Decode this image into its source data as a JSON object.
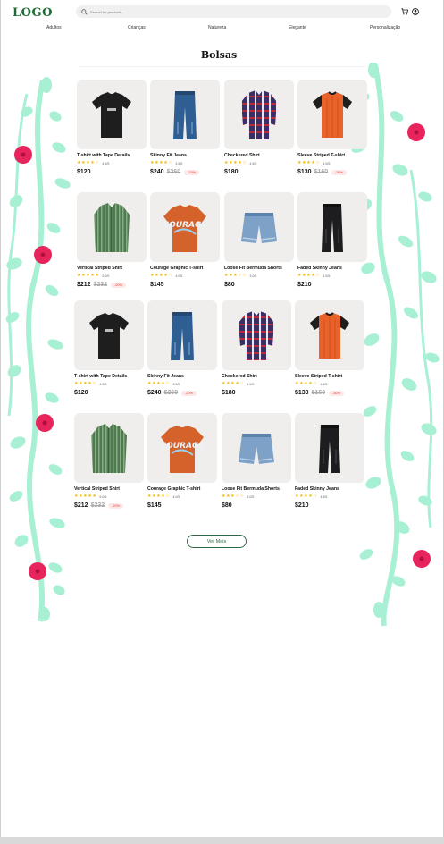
{
  "header": {
    "logo": "LOGO",
    "search_placeholder": "Search for products..."
  },
  "nav": [
    "Adultos",
    "Crianças",
    "Naturezа",
    "Elegante",
    "Personalização"
  ],
  "section": {
    "title": "Bolsas"
  },
  "products": [
    {
      "name": "T-shirt with Tape Details",
      "stars": "★★★★☆",
      "rating": "4.5/5",
      "price": "$120",
      "old_price": "",
      "discount": "",
      "image": "tshirt-black"
    },
    {
      "name": "Skinny Fit Jeans",
      "stars": "★★★★☆",
      "rating": "3.5/5",
      "price": "$240",
      "old_price": "$260",
      "discount": "-20%",
      "image": "jeans-blue"
    },
    {
      "name": "Checkered Shirt",
      "stars": "★★★★☆",
      "rating": "4.5/5",
      "price": "$180",
      "old_price": "",
      "discount": "",
      "image": "checkered-shirt"
    },
    {
      "name": "Sleeve Striped T-shirt",
      "stars": "★★★★☆",
      "rating": "4.5/5",
      "price": "$130",
      "old_price": "$160",
      "discount": "-30%",
      "image": "tshirt-orange"
    },
    {
      "name": "Vertical Striped Shirt",
      "stars": "★★★★★",
      "rating": "5.0/5",
      "price": "$212",
      "old_price": "$232",
      "discount": "-20%",
      "image": "striped-shirt"
    },
    {
      "name": "Courage Graphic T-shirt",
      "stars": "★★★★☆",
      "rating": "4.0/5",
      "price": "$145",
      "old_price": "",
      "discount": "",
      "image": "graphic-tshirt"
    },
    {
      "name": "Loose Fit Bermuda Shorts",
      "stars": "★★★☆☆",
      "rating": "3.0/5",
      "price": "$80",
      "old_price": "",
      "discount": "",
      "image": "denim-shorts"
    },
    {
      "name": "Faded Skinny Jeans",
      "stars": "★★★★☆",
      "rating": "4.5/5",
      "price": "$210",
      "old_price": "",
      "discount": "",
      "image": "jeans-black"
    },
    {
      "name": "T-shirt with Tape Details",
      "stars": "★★★★☆",
      "rating": "4.5/5",
      "price": "$120",
      "old_price": "",
      "discount": "",
      "image": "tshirt-black"
    },
    {
      "name": "Skinny Fit Jeans",
      "stars": "★★★★☆",
      "rating": "3.5/5",
      "price": "$240",
      "old_price": "$260",
      "discount": "-20%",
      "image": "jeans-blue"
    },
    {
      "name": "Checkered Shirt",
      "stars": "★★★★☆",
      "rating": "4.5/5",
      "price": "$180",
      "old_price": "",
      "discount": "",
      "image": "checkered-shirt"
    },
    {
      "name": "Sleeve Striped T-shirt",
      "stars": "★★★★☆",
      "rating": "4.5/5",
      "price": "$130",
      "old_price": "$160",
      "discount": "-30%",
      "image": "tshirt-orange"
    },
    {
      "name": "Vertical Striped Shirt",
      "stars": "★★★★★",
      "rating": "5.0/5",
      "price": "$212",
      "old_price": "$232",
      "discount": "-20%",
      "image": "striped-shirt"
    },
    {
      "name": "Courage Graphic T-shirt",
      "stars": "★★★★☆",
      "rating": "4.0/5",
      "price": "$145",
      "old_price": "",
      "discount": "",
      "image": "graphic-tshirt"
    },
    {
      "name": "Loose Fit Bermuda Shorts",
      "stars": "★★★☆☆",
      "rating": "3.0/5",
      "price": "$80",
      "old_price": "",
      "discount": "",
      "image": "denim-shorts"
    },
    {
      "name": "Faded Skinny Jeans",
      "stars": "★★★★☆",
      "rating": "4.5/5",
      "price": "$210",
      "old_price": "",
      "discount": "",
      "image": "jeans-black"
    }
  ],
  "load_more": "Ver Mais",
  "colors": {
    "brand": "#1f6b36",
    "vine": "#a8f0d4",
    "flower": "#e8245c",
    "star": "#f5b800",
    "discount": "#e53935"
  }
}
